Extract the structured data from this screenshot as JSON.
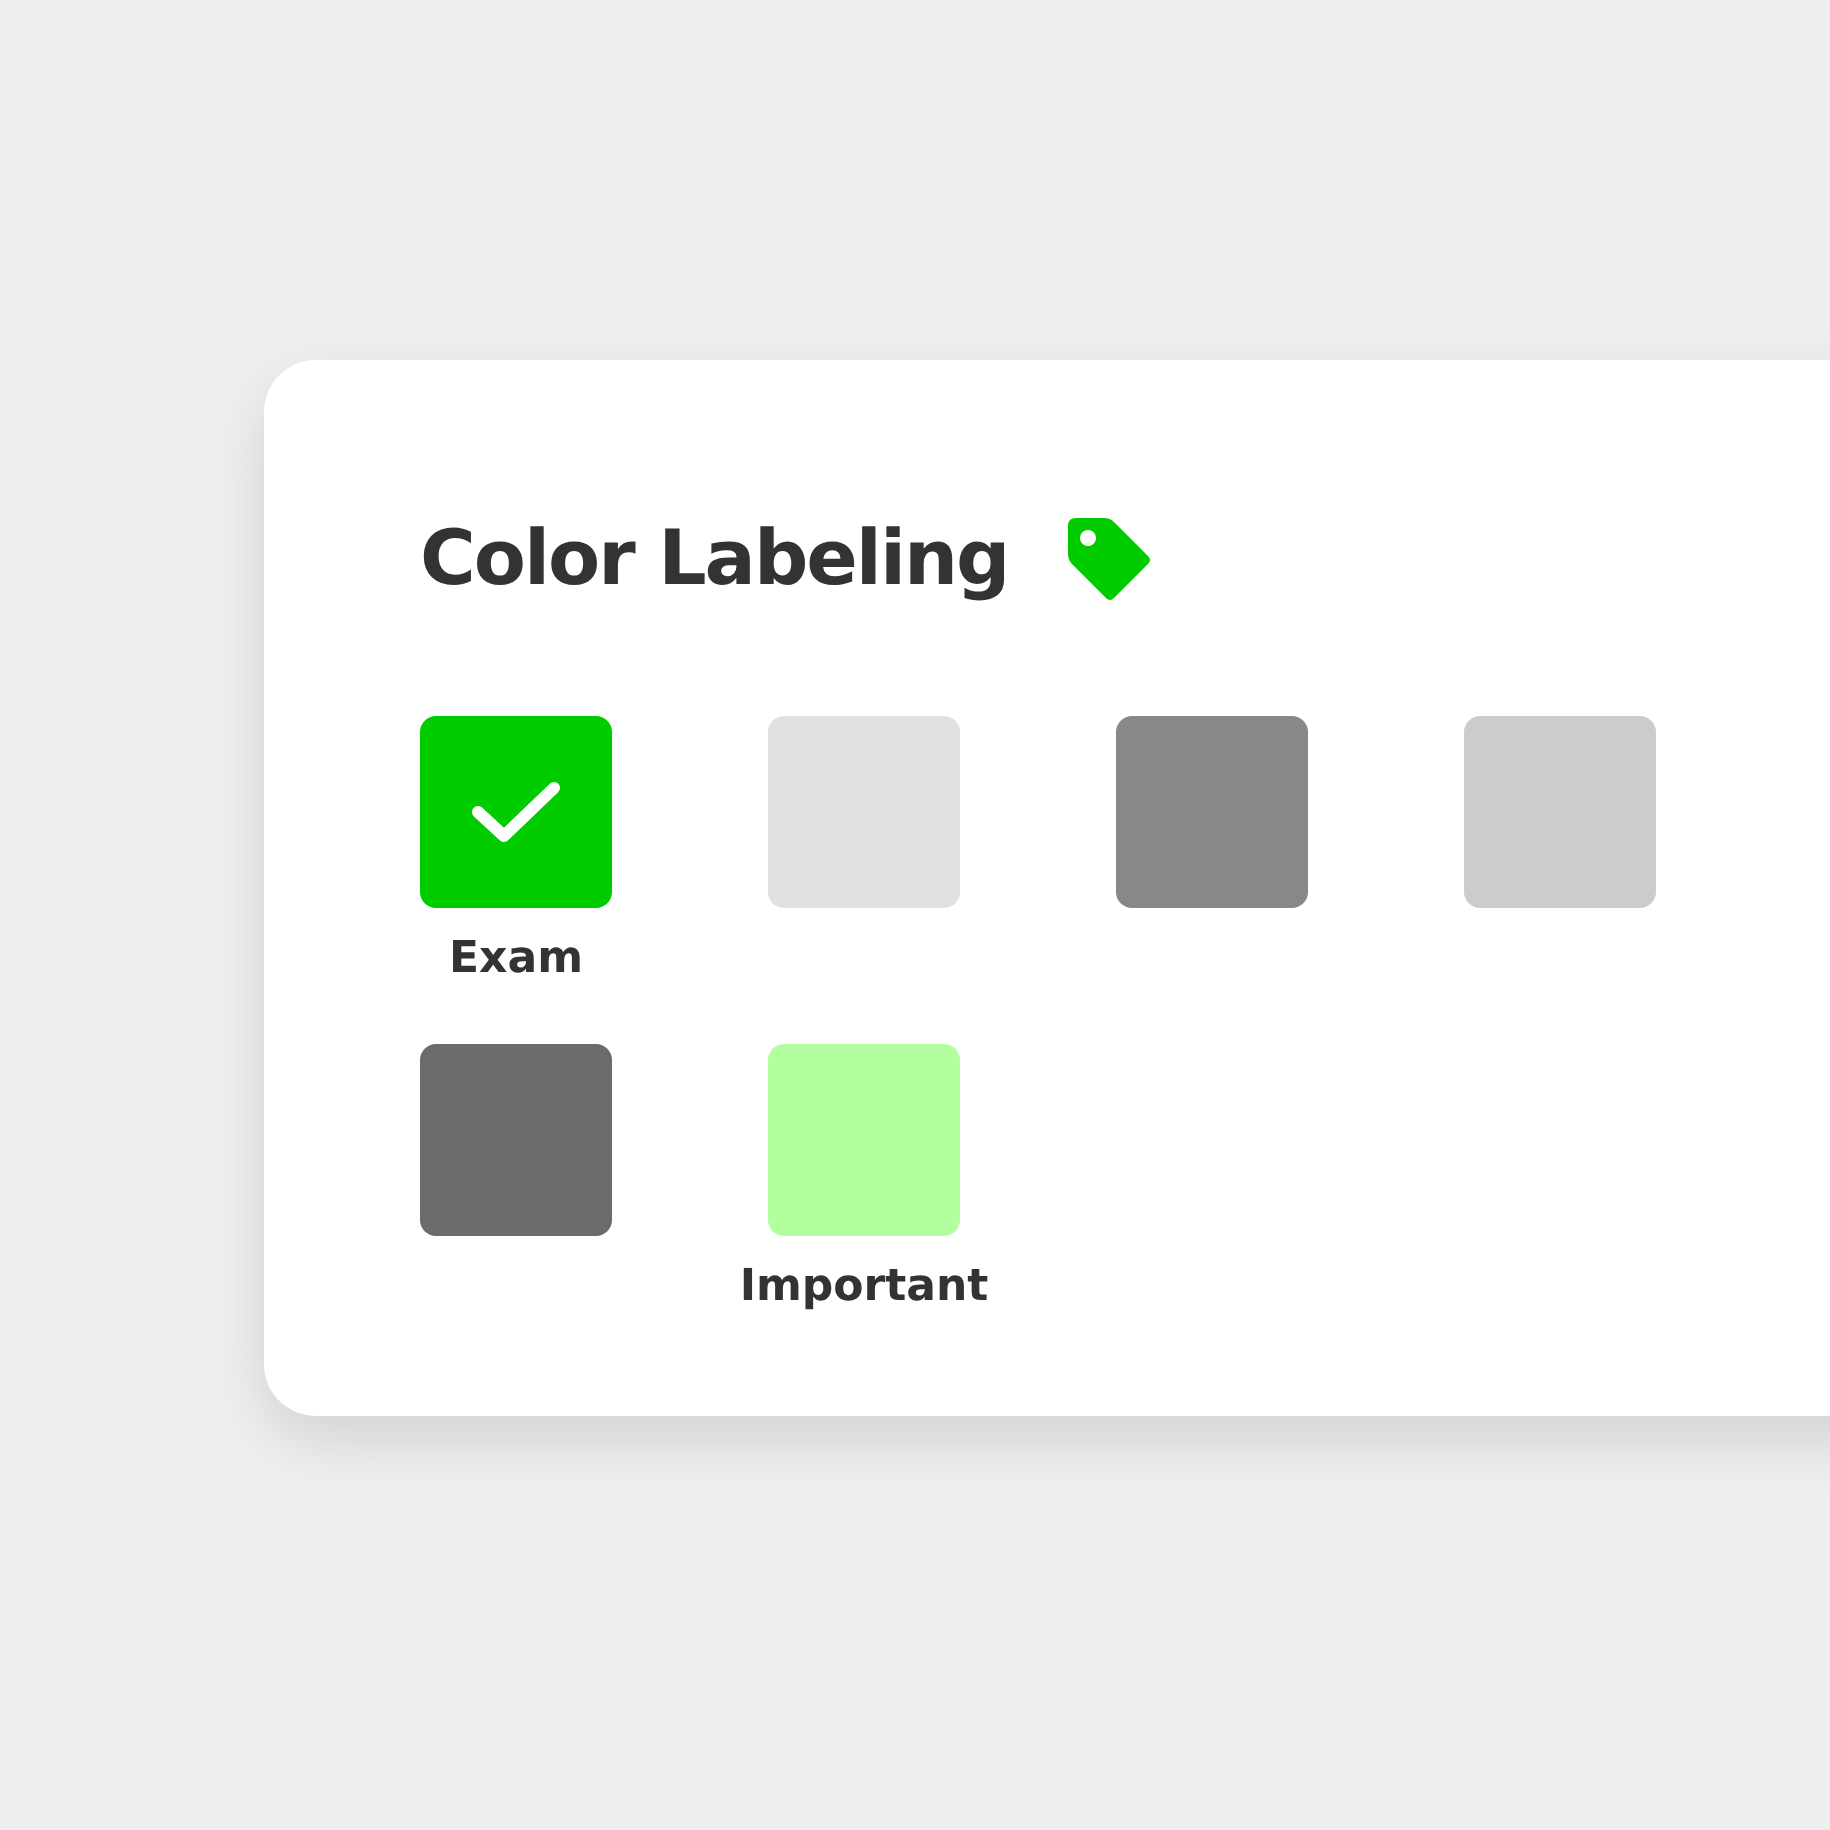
{
  "card": {
    "title": "Color Labeling",
    "labels": [
      {
        "color": "#00cc00",
        "selected": true,
        "label": "Exam"
      },
      {
        "color": "#e0e0e0",
        "selected": false
      },
      {
        "color": "#888888",
        "selected": false
      },
      {
        "color": "#cccccc",
        "selected": false
      },
      {
        "color": "#6b6b6b",
        "selected": false
      },
      {
        "color": "#b3ff9f",
        "selected": false,
        "label": "Important"
      }
    ]
  }
}
